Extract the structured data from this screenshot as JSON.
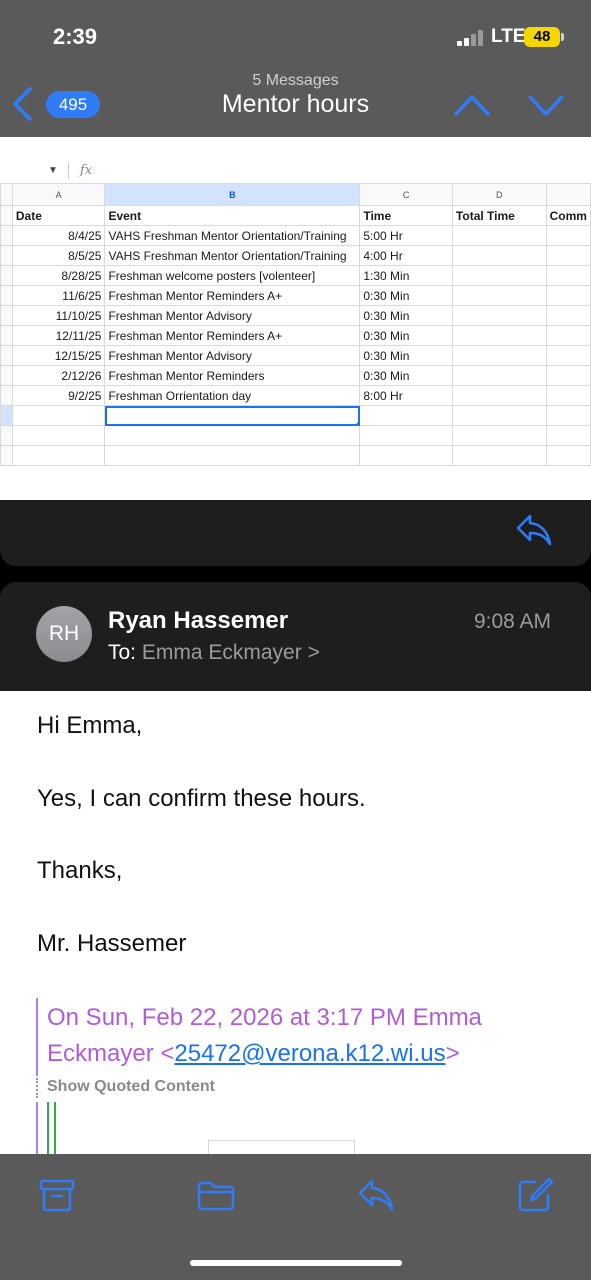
{
  "status_bar": {
    "time": "2:39",
    "network": "LTE",
    "battery": "48"
  },
  "nav": {
    "back_count": "495",
    "message_count": "5 Messages",
    "title": "Mentor hours"
  },
  "sheet": {
    "fx_label": "fx",
    "col_headers": [
      "A",
      "B",
      "C",
      "D",
      ""
    ],
    "headers": [
      "Date",
      "Event",
      "Time",
      "Total Time",
      "Comm"
    ],
    "rows": [
      [
        "8/4/25",
        "VAHS Freshman Mentor Orientation/Training",
        "5:00 Hr"
      ],
      [
        "8/5/25",
        "VAHS Freshman Mentor Orientation/Training",
        "4:00 Hr"
      ],
      [
        "8/28/25",
        "Freshman welcome posters [volenteer]",
        "1:30 Min"
      ],
      [
        "11/6/25",
        "Freshman Mentor Reminders A+",
        "0:30 Min"
      ],
      [
        "11/10/25",
        "Freshman Mentor Advisory",
        "0:30 Min"
      ],
      [
        "12/11/25",
        "Freshman Mentor Reminders A+",
        "0:30 Min"
      ],
      [
        "12/15/25",
        "Freshman Mentor Advisory",
        "0:30 Min"
      ],
      [
        "2/12/26",
        "Freshman Mentor Reminders",
        "0:30 Min"
      ],
      [
        "9/2/25",
        "Freshman Orrientation day",
        "8:00 Hr"
      ]
    ]
  },
  "message": {
    "avatar_initials": "RH",
    "sender": "Ryan Hassemer",
    "time": "9:08 AM",
    "to_label": "To:",
    "to_name": "Emma Eckmayer",
    "to_chevron": ">",
    "body": {
      "greeting": "Hi Emma,",
      "line1": "Yes, I can confirm these hours.",
      "closing": "Thanks,",
      "signature": "Mr. Hassemer"
    },
    "quote": {
      "header_prefix": "On Sun, Feb 22, 2026 at 3:17 PM Emma Eckmayer <",
      "email": "25472@verona.k12.wi.us",
      "header_suffix": ">",
      "show_quoted": "Show Quoted Content"
    }
  },
  "colors": {
    "accent": "#2f7cf6",
    "quote": "#b15cd6",
    "header_bg": "#5a5a5a"
  },
  "icons": {
    "back": "chevron-left-icon",
    "up": "chevron-up-icon",
    "down": "chevron-down-icon",
    "reply": "reply-icon",
    "archive": "archive-icon",
    "folder": "folder-icon",
    "compose": "compose-icon"
  }
}
